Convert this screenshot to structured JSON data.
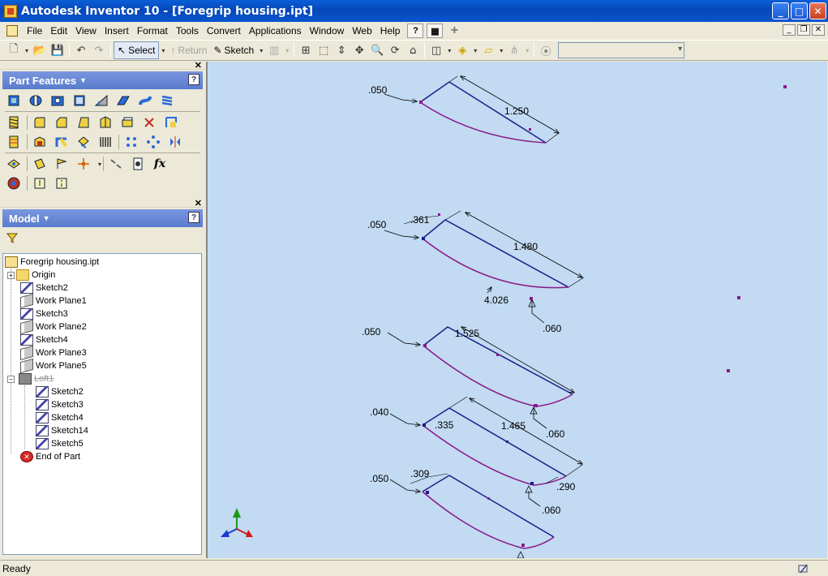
{
  "window": {
    "title": "Autodesk Inventor 10 - [Foregrip housing.ipt]",
    "min_label": "_",
    "max_label": "□",
    "close_label": "✕"
  },
  "menu": {
    "items": [
      "File",
      "Edit",
      "View",
      "Insert",
      "Format",
      "Tools",
      "Convert",
      "Applications",
      "Window",
      "Web",
      "Help"
    ]
  },
  "toolbar": {
    "select_label": "Select",
    "return_label": "Return",
    "sketch_label": "Sketch",
    "combo_value": ""
  },
  "part_features": {
    "title": "Part Features",
    "help": "?",
    "fx_label": "fx"
  },
  "model": {
    "title": "Model",
    "help": "?",
    "tree": [
      {
        "label": "Foregrip housing.ipt",
        "icon": "part-icon",
        "level": 0
      },
      {
        "label": "Origin",
        "icon": "folder-icon",
        "level": 1,
        "expander": "+"
      },
      {
        "label": "Sketch2",
        "icon": "sketch-icon",
        "level": 1
      },
      {
        "label": "Work Plane1",
        "icon": "work-plane-icon",
        "level": 1
      },
      {
        "label": "Sketch3",
        "icon": "sketch-icon",
        "level": 1
      },
      {
        "label": "Work Plane2",
        "icon": "work-plane-icon",
        "level": 1
      },
      {
        "label": "Sketch4",
        "icon": "sketch-icon",
        "level": 1
      },
      {
        "label": "Work Plane3",
        "icon": "work-plane-icon",
        "level": 1
      },
      {
        "label": "Work Plane5",
        "icon": "work-plane-icon",
        "level": 1
      },
      {
        "label": "Loft1",
        "icon": "loft-icon",
        "level": 1,
        "expander": "−",
        "struck": true
      },
      {
        "label": "Sketch2",
        "icon": "sketch-icon",
        "level": 2
      },
      {
        "label": "Sketch3",
        "icon": "sketch-icon",
        "level": 2
      },
      {
        "label": "Sketch4",
        "icon": "sketch-icon",
        "level": 2
      },
      {
        "label": "Sketch14",
        "icon": "sketch-icon",
        "level": 2
      },
      {
        "label": "Sketch5",
        "icon": "sketch-icon",
        "level": 2
      },
      {
        "label": "End of Part",
        "icon": "end-of-part-icon",
        "level": 1
      }
    ]
  },
  "viewport": {
    "dims": {
      "s1_050": ".050",
      "s1_len": "1.250",
      "s2_050": ".050",
      "s2_361": ".361",
      "s2_len": "1.480",
      "s2_rad": "4.026",
      "s2_060": ".060",
      "s3_050": ".050",
      "s3_len": "1.525",
      "s4_040": ".040",
      "s4_335": ".335",
      "s4_len": "1.465",
      "s4_060": ".060",
      "s4_290": ".290",
      "s4_060b": ".060",
      "s5_050": ".050",
      "s5_309": ".309"
    },
    "colors": {
      "background": "#c2daf2",
      "profile_blue": "#1c1c8a",
      "profile_magenta": "#8a1a8a",
      "dim_line": "#000000"
    }
  },
  "status": {
    "text": "Ready"
  }
}
